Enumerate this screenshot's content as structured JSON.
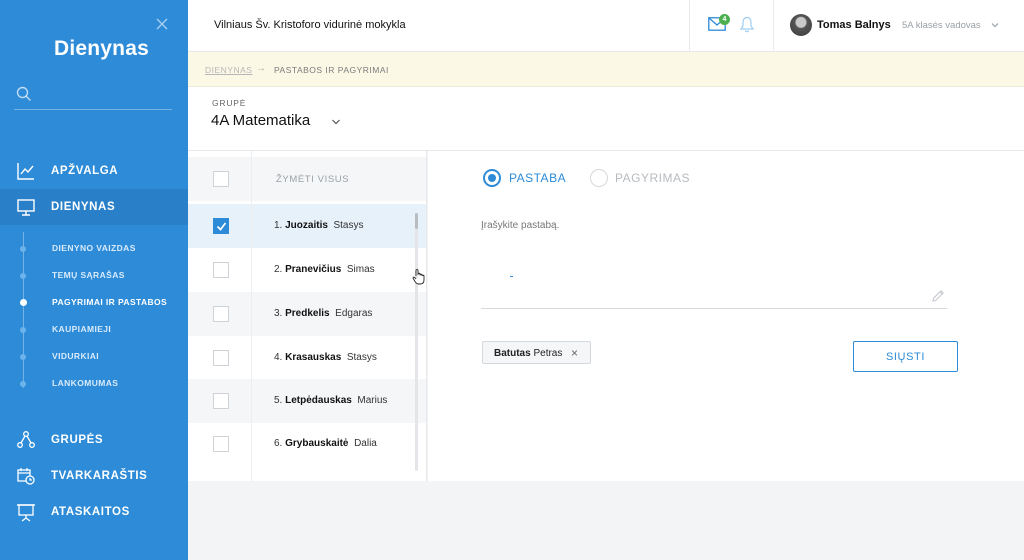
{
  "app": {
    "logo": "Dienynas"
  },
  "header": {
    "school": "Vilniaus Šv. Kristoforo vidurinė mokykla",
    "mail_count": "4",
    "user_name": "Tomas Balnys",
    "user_role": "5A klasės vadovas"
  },
  "sidebar": {
    "items": [
      {
        "label": "APŽVALGA",
        "icon": "chart-trend-icon"
      },
      {
        "label": "DIENYNAS",
        "icon": "monitor-icon"
      },
      {
        "label": "GRUPĖS",
        "icon": "group-nodes-icon"
      },
      {
        "label": "TVARKARAŠTIS",
        "icon": "calendar-clock-icon"
      },
      {
        "label": "ATASKAITOS",
        "icon": "presentation-icon"
      }
    ],
    "subitems": [
      {
        "label": "DIENYNO VAIZDAS"
      },
      {
        "label": "TEMŲ SĄRAŠAS"
      },
      {
        "label": "PAGYRIMAI IR PASTABOS"
      },
      {
        "label": "KAUPIAMIEJI"
      },
      {
        "label": "VIDURKIAI"
      },
      {
        "label": "LANKOMUMAS"
      }
    ],
    "active_item": "DIENYNAS",
    "active_subitem": "PAGYRIMAI IR PASTABOS"
  },
  "breadcrumb": {
    "root": "DIENYNAS",
    "arrow": "→",
    "current": "PASTABOS IR PAGYRIMAI"
  },
  "group": {
    "label": "GRUPĖ",
    "value": "4A Matematika"
  },
  "list": {
    "select_all": "ŽYMĖTI VISUS",
    "students": [
      {
        "index": "1.",
        "last": "Juozaitis",
        "first": "Stasys",
        "checked": true
      },
      {
        "index": "2.",
        "last": "Pranevičius",
        "first": "Simas",
        "checked": false
      },
      {
        "index": "3.",
        "last": "Predkelis",
        "first": "Edgaras",
        "checked": false
      },
      {
        "index": "4.",
        "last": "Krasauskas",
        "first": "Stasys",
        "checked": false
      },
      {
        "index": "5.",
        "last": "Letpėdauskas",
        "first": "Marius",
        "checked": false
      },
      {
        "index": "6.",
        "last": "Grybauskaitė",
        "first": "Dalia",
        "checked": false
      }
    ]
  },
  "form": {
    "type_options": [
      {
        "label": "PASTABA",
        "selected": true
      },
      {
        "label": "PAGYRIMAS",
        "selected": false
      }
    ],
    "textarea_label": "Įrašykite pastabą.",
    "recipient": {
      "last": "Batutas",
      "first": "Petras"
    },
    "send_label": "SIŲSTI"
  },
  "colors": {
    "sidebar": "#2d8bd8",
    "accent": "#2d8bd8",
    "breadcrumb_bg": "#fbf8e6",
    "badge": "#4caf50"
  }
}
